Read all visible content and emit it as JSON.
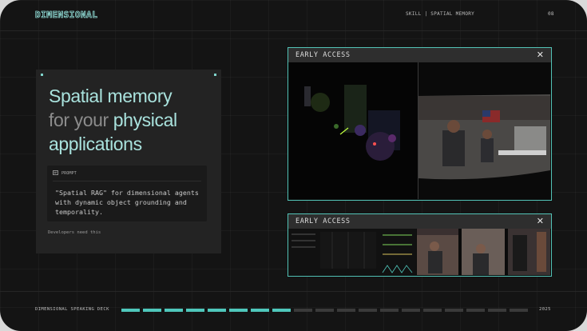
{
  "header": {
    "logo": "DIMENSIONAL",
    "section": "SKILL | SPATIAL MEMORY",
    "slide_number": "08"
  },
  "card": {
    "title_part1": "Spatial memory",
    "title_part2": "for your",
    "title_part3": "physical",
    "title_part4": "applications",
    "prompt_label": "PROMPT",
    "prompt_text": "\"Spatial RAG\" for dimensional agents with dynamic object grounding and temporality.",
    "footnote": "Developers need this"
  },
  "windows": [
    {
      "title": "EARLY ACCESS",
      "close_label": "✕"
    },
    {
      "title": "EARLY ACCESS",
      "close_label": "✕"
    }
  ],
  "footer": {
    "deck_name": "DIMENSIONAL SPEAKING DECK",
    "year": "2025",
    "progress": {
      "current": 8,
      "total": 19
    }
  },
  "colors": {
    "accent": "#4fc7bb",
    "title_highlight": "#a9e2dd",
    "title_muted": "#8c8c8c",
    "background": "#141414"
  }
}
